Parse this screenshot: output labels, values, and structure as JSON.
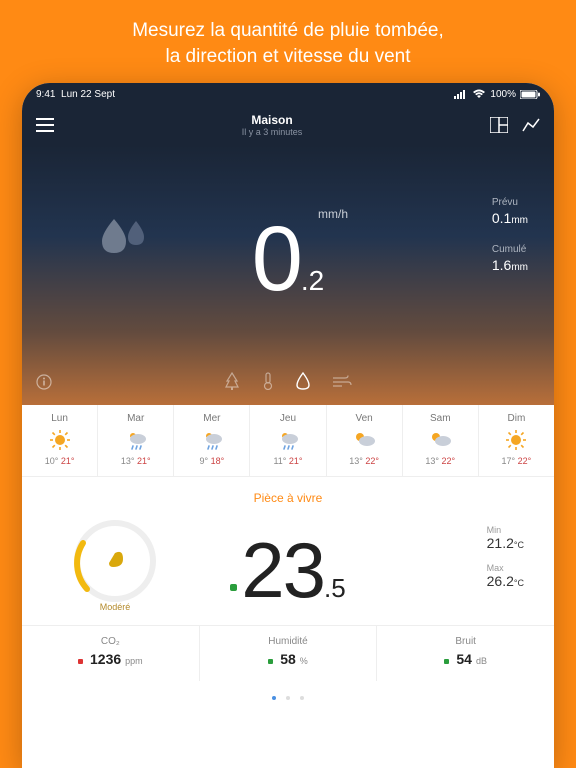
{
  "promo": {
    "line1": "Mesurez la quantité de pluie tombée,",
    "line2": "la direction et vitesse du vent"
  },
  "statusbar": {
    "time": "9:41",
    "date": "Lun 22 Sept",
    "battery": "100%"
  },
  "header": {
    "title": "Maison",
    "subtitle": "Il y a 3 minutes"
  },
  "rain": {
    "integer": "0",
    "decimal": ".2",
    "unit": "mm/h",
    "forecast_label": "Prévu",
    "forecast_value": "0.1",
    "forecast_unit": "mm",
    "total_label": "Cumulé",
    "total_value": "1.6",
    "total_unit": "mm"
  },
  "forecast": [
    {
      "day": "Lun",
      "icon": "sunny",
      "lo": "10°",
      "hi": "21°"
    },
    {
      "day": "Mar",
      "icon": "rain",
      "lo": "13°",
      "hi": "21°"
    },
    {
      "day": "Mer",
      "icon": "rain",
      "lo": "9°",
      "hi": "18°"
    },
    {
      "day": "Jeu",
      "icon": "rain",
      "lo": "11°",
      "hi": "21°"
    },
    {
      "day": "Ven",
      "icon": "partly",
      "lo": "13°",
      "hi": "22°"
    },
    {
      "day": "Sam",
      "icon": "partly",
      "lo": "13°",
      "hi": "22°"
    },
    {
      "day": "Dim",
      "icon": "sunny",
      "lo": "17°",
      "hi": "22°"
    }
  ],
  "room": {
    "title": "Pièce à vivre",
    "gauge_label": "Modéré",
    "temp_integer": "23",
    "temp_decimal": ".5",
    "temp_unit": "°C",
    "min_label": "Min",
    "min_value": "21.2",
    "min_unit": "°C",
    "max_label": "Max",
    "max_value": "26.2",
    "max_unit": "°C"
  },
  "metrics": {
    "co2_label": "CO₂",
    "co2_value": "1236",
    "co2_unit": "ppm",
    "humidity_label": "Humidité",
    "humidity_value": "58",
    "humidity_unit": "%",
    "noise_label": "Bruit",
    "noise_value": "54",
    "noise_unit": "dB"
  }
}
